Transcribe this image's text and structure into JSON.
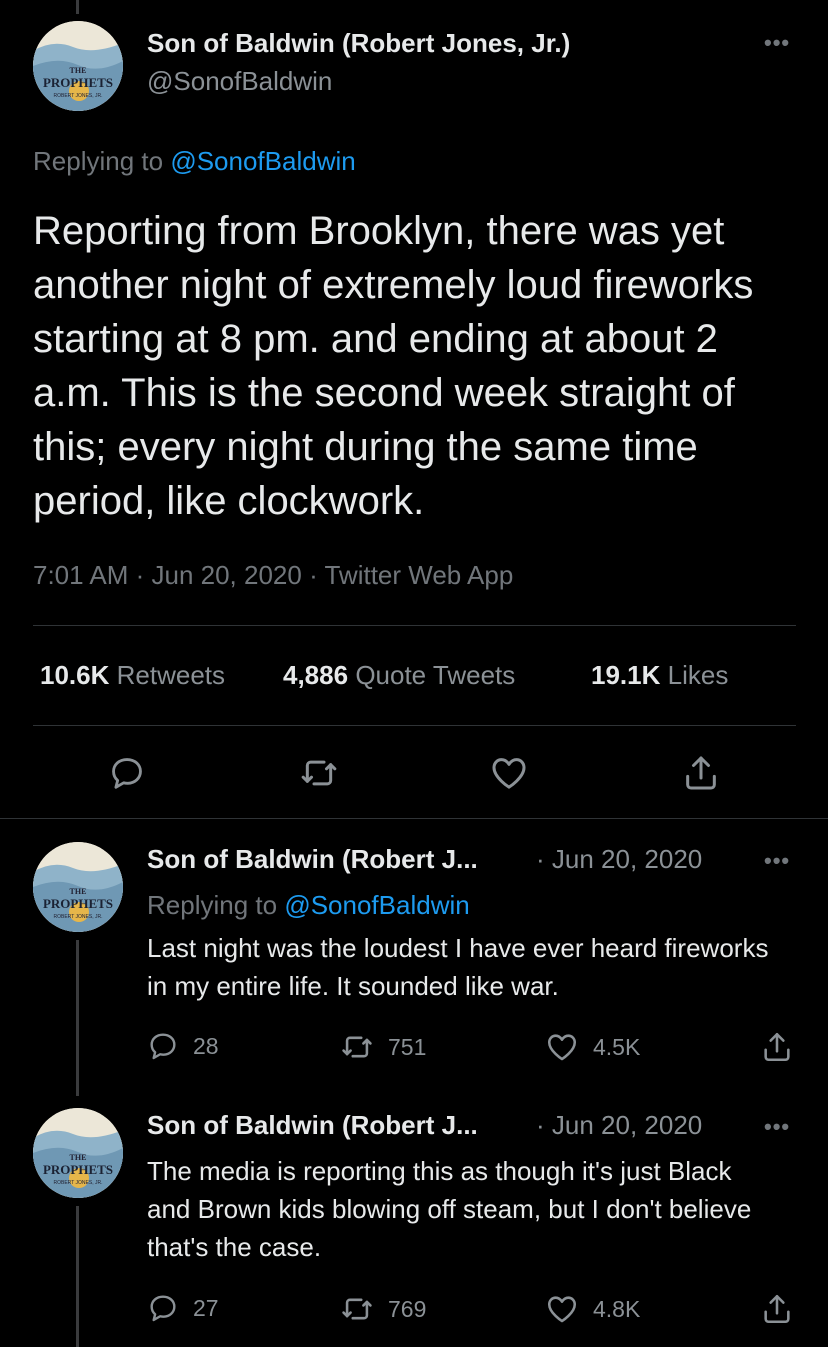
{
  "avatar_text": {
    "line1": "THE",
    "line2": "PROPHETS",
    "line3": "ROBERT JONES, JR."
  },
  "main_tweet": {
    "name": "Son of Baldwin (Robert Jones, Jr.)",
    "handle": "@SonofBaldwin",
    "replying_prefix": "Replying to",
    "replying_handle": "@SonofBaldwin",
    "text": "Reporting from Brooklyn, there was yet another night of extremely loud fireworks starting at 8 pm. and ending at about 2 a.m. This is the second week straight of this; every night during the same time period, like clockwork.",
    "meta": "7:01 AM · Jun 20, 2020 · Twitter Web App",
    "stats": {
      "retweets_count": "10.6K",
      "retweets_label": "Retweets",
      "quotes_count": "4,886",
      "quotes_label": "Quote Tweets",
      "likes_count": "19.1K",
      "likes_label": "Likes"
    },
    "icons": [
      "reply-icon",
      "retweet-icon",
      "like-icon",
      "share-icon"
    ]
  },
  "replies": [
    {
      "name": "Son of Baldwin (Robert J...",
      "date": "· Jun 20, 2020",
      "replying_prefix": "Replying to",
      "replying_handle": "@SonofBaldwin",
      "text": "Last night was the loudest I have ever heard fireworks in my entire life. It sounded like war.",
      "replies": "28",
      "retweets": "751",
      "likes": "4.5K"
    },
    {
      "name": "Son of Baldwin (Robert J...",
      "date": "· Jun 20, 2020",
      "text": "The media is reporting this as though it's just Black and Brown kids blowing off steam, but I don't believe that's the case.",
      "replies": "27",
      "retweets": "769",
      "likes": "4.8K"
    }
  ],
  "more_label": "•••",
  "colors": {
    "background": "#000000",
    "link": "#1d9bf0",
    "muted": "#71767b",
    "divider": "#2f3336"
  }
}
